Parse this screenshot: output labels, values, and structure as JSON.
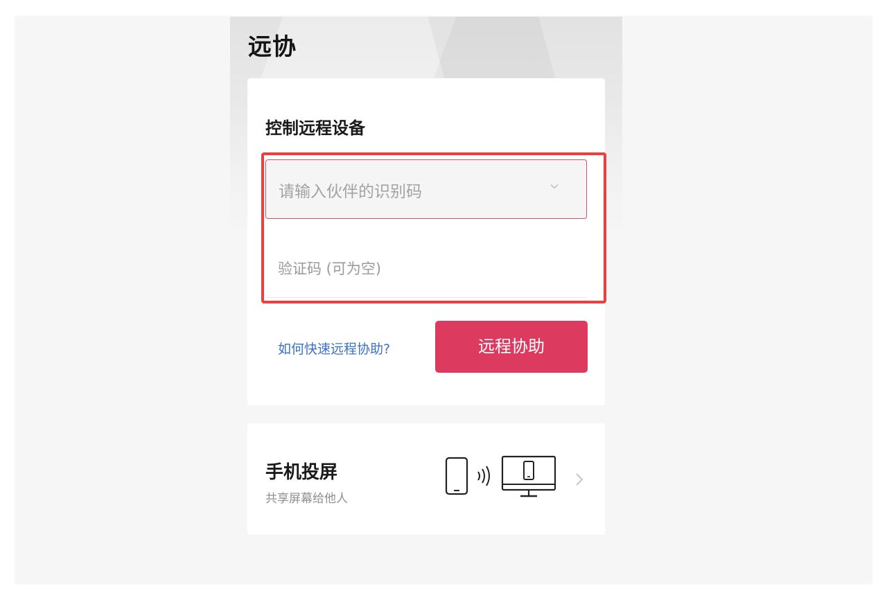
{
  "app": {
    "title": "远协"
  },
  "remote_control": {
    "section_title": "控制远程设备",
    "partner_id": {
      "placeholder": "请输入伙伴的识别码",
      "value": "",
      "icon": "chevron-down-icon"
    },
    "verification": {
      "placeholder": "验证码 (可为空)",
      "value": ""
    },
    "help_link": "如何快速远程协助?",
    "submit_label": "远程协助"
  },
  "screen_cast": {
    "title": "手机投屏",
    "subtitle": "共享屏幕给他人",
    "illustration_icon": "phone-to-monitor-cast-icon",
    "arrow_icon": "chevron-right-icon"
  },
  "colors": {
    "accent": "#dd3a5f",
    "link": "#3b72c8",
    "highlight": "#f03d3d",
    "background": "#f6f6f6"
  }
}
